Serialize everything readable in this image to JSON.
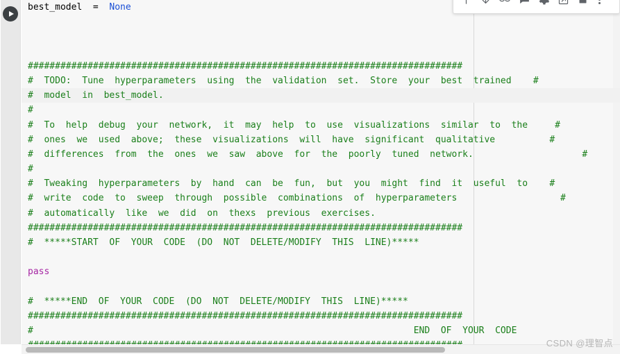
{
  "app": {
    "kind": "jupyter-notebook-code-cell",
    "watermark": "CSDN @理智点"
  },
  "toolbar": {
    "buttons": [
      {
        "name": "move-cell-up-icon",
        "label": "Move cell up"
      },
      {
        "name": "move-cell-down-icon",
        "label": "Move cell down"
      },
      {
        "name": "link-to-cell-icon",
        "label": "Link to cell"
      },
      {
        "name": "add-comment-icon",
        "label": "Add a comment"
      },
      {
        "name": "cell-settings-icon",
        "label": "Cell settings"
      },
      {
        "name": "open-in-new-tab-icon",
        "label": "Open in new tab"
      },
      {
        "name": "delete-cell-icon",
        "label": "Delete cell"
      }
    ],
    "overflow_label": "More cell actions"
  },
  "run_button": {
    "label": "Run cell",
    "icon": "play-icon"
  },
  "scrollbars": {
    "horizontal_label": "Horizontal scrollbar",
    "vertical_label": "Vertical scrollbar"
  },
  "colors": {
    "comment": "#1a7f1a",
    "keyword": "#a626a4",
    "constant": "#1a4fd6",
    "plain": "#000000",
    "gutter": "#e8e8e8",
    "editor_background": "#f7f7f7",
    "watermark": "#b6b6b6"
  },
  "editor": {
    "lines": [
      {
        "band": false,
        "segments": [
          {
            "cls": "tok-plain",
            "text": "best_model  =  "
          },
          {
            "cls": "tok-const",
            "text": "None"
          }
        ]
      },
      {
        "band": false,
        "segments": []
      },
      {
        "band": false,
        "segments": []
      },
      {
        "band": false,
        "segments": []
      },
      {
        "band": false,
        "segments": [
          {
            "cls": "tok-cmt",
            "text": "################################################################################"
          }
        ]
      },
      {
        "band": false,
        "segments": [
          {
            "cls": "tok-cmt",
            "text": "#  TODO:  Tune  hyperparameters  using  the  validation  set.  Store  your  best  trained    #"
          }
        ]
      },
      {
        "band": true,
        "segments": [
          {
            "cls": "tok-cmt",
            "text": "#  model  in  best_model."
          }
        ]
      },
      {
        "band": false,
        "segments": [
          {
            "cls": "tok-cmt",
            "text": "#"
          }
        ]
      },
      {
        "band": false,
        "segments": [
          {
            "cls": "tok-cmt",
            "text": "#  To  help  debug  your  network,  it  may  help  to  use  visualizations  similar  to  the     #"
          }
        ]
      },
      {
        "band": false,
        "segments": [
          {
            "cls": "tok-cmt",
            "text": "#  ones  we  used  above;  these  visualizations  will  have  significant  qualitative          #"
          }
        ]
      },
      {
        "band": false,
        "segments": [
          {
            "cls": "tok-cmt",
            "text": "#  differences  from  the  ones  we  saw  above  for  the  poorly  tuned  network.                    #"
          }
        ]
      },
      {
        "band": false,
        "segments": [
          {
            "cls": "tok-cmt",
            "text": "#"
          }
        ]
      },
      {
        "band": false,
        "segments": [
          {
            "cls": "tok-cmt",
            "text": "#  Tweaking  hyperparameters  by  hand  can  be  fun,  but  you  might  find  it  useful  to    #"
          }
        ]
      },
      {
        "band": false,
        "segments": [
          {
            "cls": "tok-cmt",
            "text": "#  write  code  to  sweep  through  possible  combinations  of  hyperparameters                   #"
          }
        ]
      },
      {
        "band": false,
        "segments": [
          {
            "cls": "tok-cmt",
            "text": "#  automatically  like  we  did  on  thexs  previous  exercises."
          }
        ]
      },
      {
        "band": false,
        "segments": [
          {
            "cls": "tok-cmt",
            "text": "################################################################################"
          }
        ]
      },
      {
        "band": false,
        "segments": [
          {
            "cls": "tok-cmt",
            "text": "#  *****START  OF  YOUR  CODE  (DO  NOT  DELETE/MODIFY  THIS  LINE)*****"
          }
        ]
      },
      {
        "band": false,
        "segments": []
      },
      {
        "band": false,
        "segments": [
          {
            "cls": "tok-kw",
            "text": "pass"
          }
        ]
      },
      {
        "band": false,
        "segments": []
      },
      {
        "band": false,
        "segments": [
          {
            "cls": "tok-cmt",
            "text": "#  *****END  OF  YOUR  CODE  (DO  NOT  DELETE/MODIFY  THIS  LINE)*****"
          }
        ]
      },
      {
        "band": false,
        "segments": [
          {
            "cls": "tok-cmt",
            "text": "################################################################################"
          }
        ]
      },
      {
        "band": false,
        "segments": [
          {
            "cls": "tok-cmt",
            "text": "#                                                                      END  OF  YOUR  CODE"
          }
        ]
      },
      {
        "band": false,
        "segments": [
          {
            "cls": "tok-cmt",
            "text": "################################################################################"
          }
        ]
      }
    ]
  }
}
